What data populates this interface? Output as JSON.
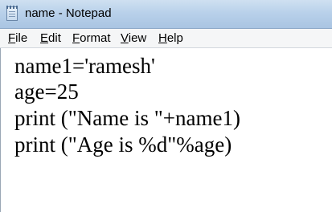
{
  "window": {
    "title": "name - Notepad",
    "app_icon": "notepad-icon"
  },
  "menu": {
    "items": [
      {
        "label": "File"
      },
      {
        "label": "Edit"
      },
      {
        "label": "Format"
      },
      {
        "label": "View"
      },
      {
        "label": "Help"
      }
    ]
  },
  "editor": {
    "lines": [
      "name1='ramesh'",
      "age=25",
      "print (\"Name is \"+name1)",
      "print (\"Age is %d\"%age)"
    ]
  }
}
